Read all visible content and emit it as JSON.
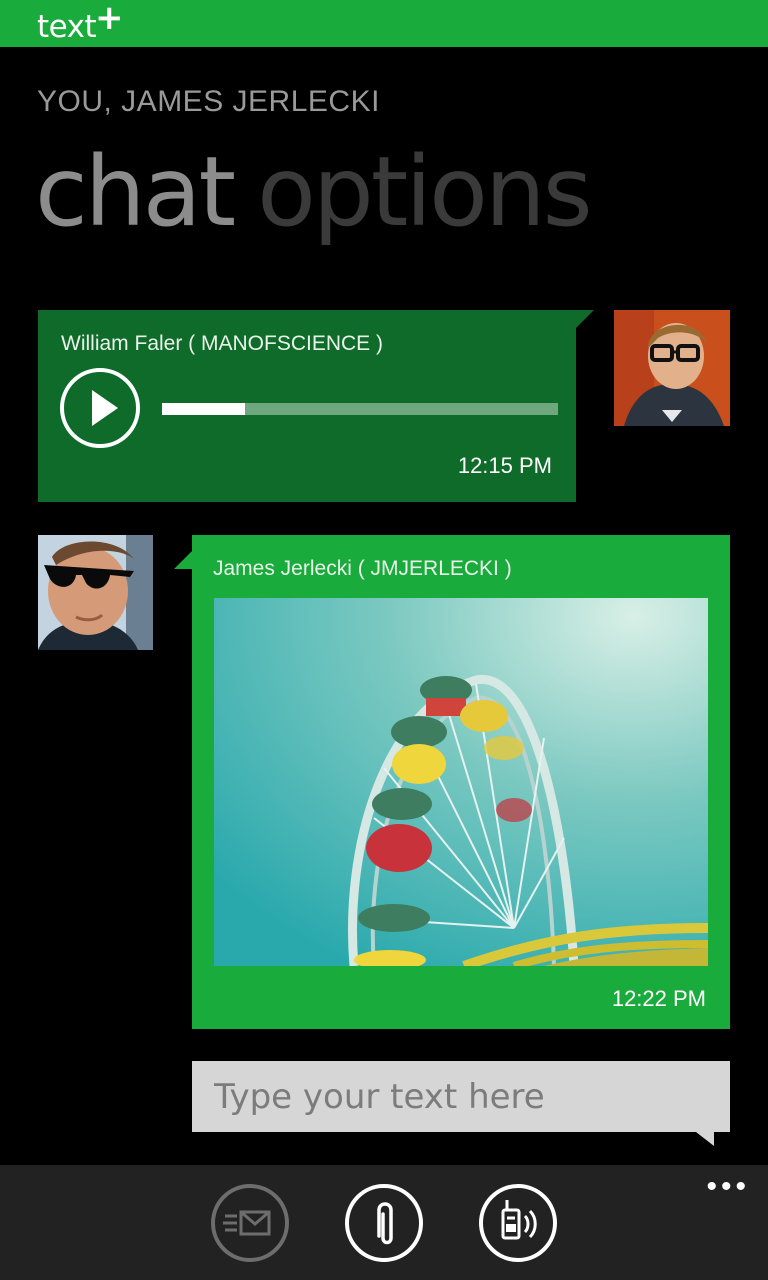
{
  "app": {
    "brand": "text",
    "brand_plus": "+"
  },
  "header": {
    "subtitle": "YOU, JAMES JERLECKI"
  },
  "pivot": {
    "active": "chat",
    "inactive": "options"
  },
  "messages": [
    {
      "sender": "William Faler ( MANOFSCIENCE )",
      "type": "audio",
      "time": "12:15 PM",
      "progress": 0.21
    },
    {
      "sender": "James Jerlecki  ( JMJERLECKI )",
      "type": "image",
      "time": "12:22 PM"
    }
  ],
  "compose": {
    "placeholder": "Type your text here"
  },
  "appbar": {
    "buttons": [
      {
        "icon": "message-envelope-icon",
        "enabled": false
      },
      {
        "icon": "paperclip-icon",
        "enabled": true
      },
      {
        "icon": "walkie-talkie-icon",
        "enabled": true
      }
    ],
    "more": "•••"
  },
  "colors": {
    "accent": "#19ab3b",
    "accent_dark": "#0f6b2a",
    "background": "#000000"
  }
}
